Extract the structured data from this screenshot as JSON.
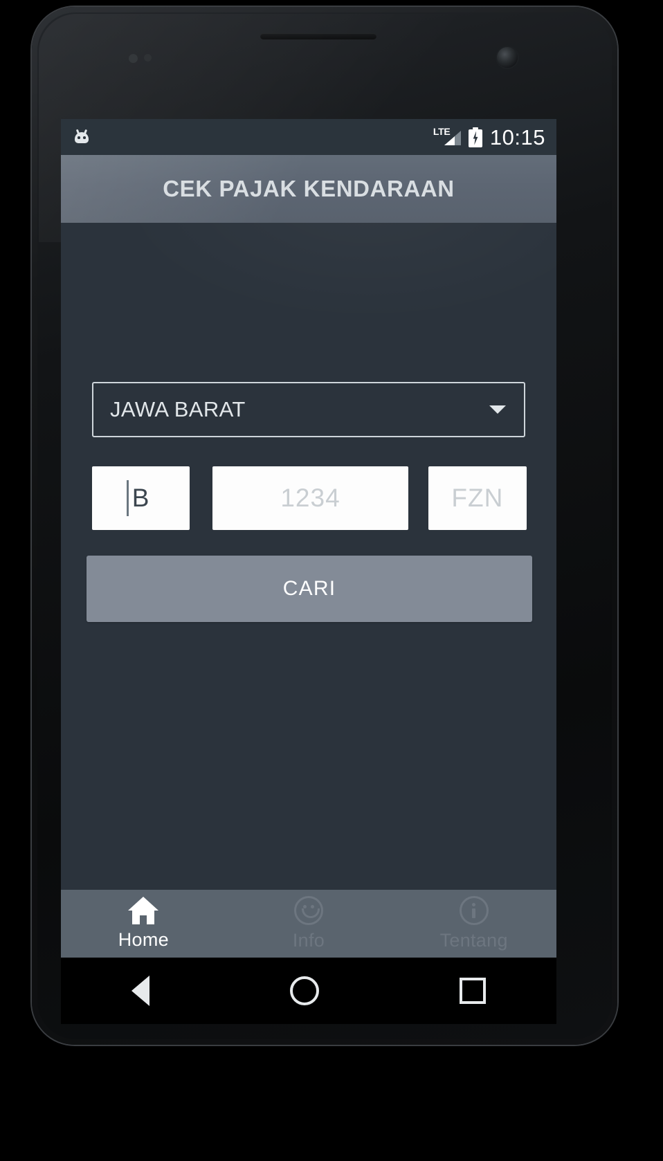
{
  "status_bar": {
    "notification_icon": "android-mascot-icon",
    "network_type": "LTE",
    "signal_icon": "signal-bars-icon",
    "battery_icon": "battery-charging-icon",
    "time": "10:15"
  },
  "app_bar": {
    "title": "CEK PAJAK KENDARAAN"
  },
  "form": {
    "region_spinner": {
      "selected": "JAWA BARAT",
      "caret_icon": "chevron-down-icon"
    },
    "plate_prefix": {
      "value": "B",
      "placeholder": "B"
    },
    "plate_number": {
      "value": "",
      "placeholder": "1234"
    },
    "plate_suffix": {
      "value": "",
      "placeholder": "FZN"
    },
    "submit_label": "CARI"
  },
  "tab_bar": {
    "tabs": [
      {
        "label": "Home",
        "icon": "home-icon",
        "state": "active"
      },
      {
        "label": "Info",
        "icon": "smiley-face-icon",
        "state": "inactive"
      },
      {
        "label": "Tentang",
        "icon": "info-circle-icon",
        "state": "inactive"
      }
    ]
  },
  "system_nav": {
    "back": "back-triangle-icon",
    "home": "home-circle-icon",
    "recents": "recents-square-icon"
  },
  "colors": {
    "status_bar_bg": "#2b343c",
    "app_bar_bg": "#5d6673",
    "content_bg": "#2b333c",
    "button_bg": "#838b97",
    "tab_bar_bg": "#5a646e",
    "tab_active": "#ffffff",
    "tab_inactive": "#6d7680",
    "field_bg": "#fdfdfd",
    "placeholder": "#c9ced2"
  }
}
